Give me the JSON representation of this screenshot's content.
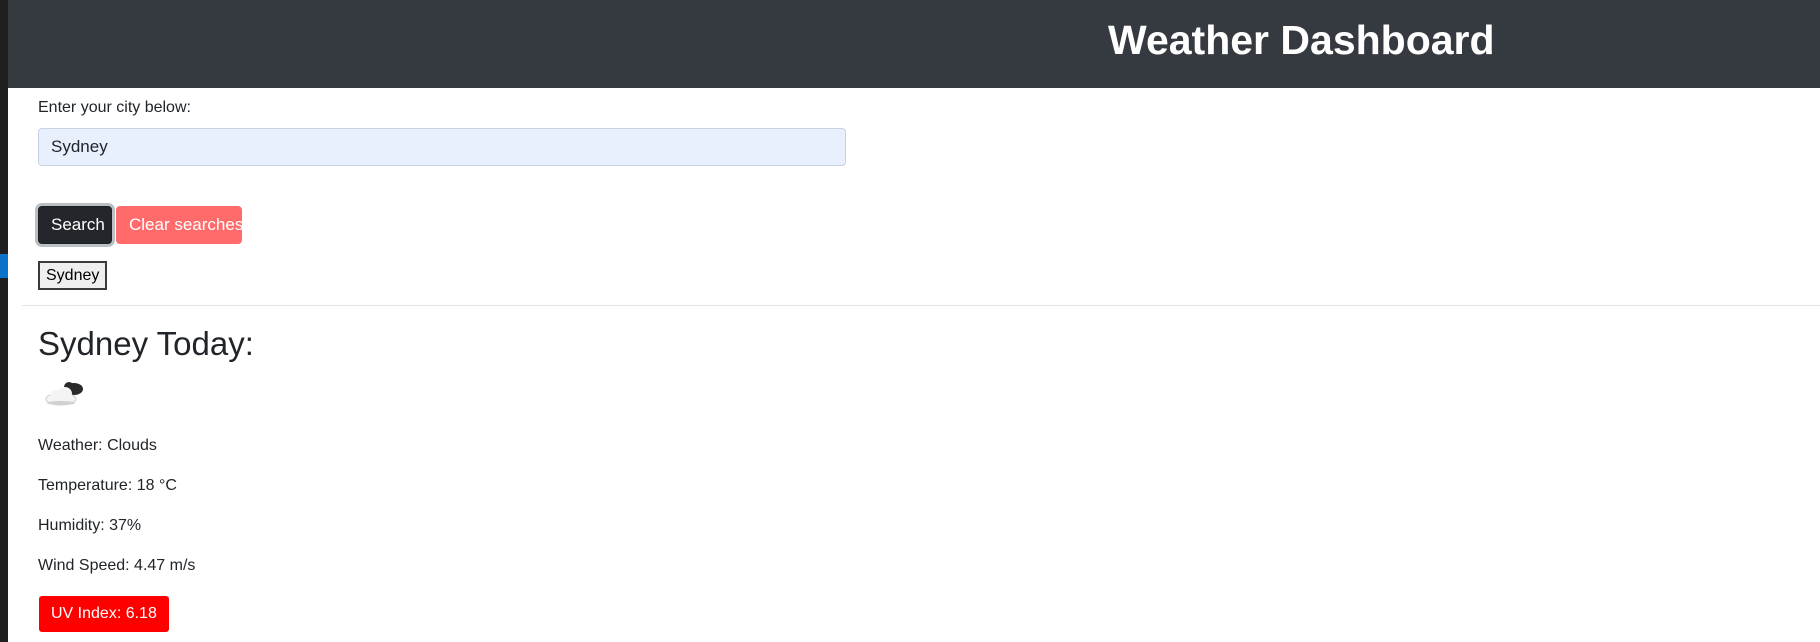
{
  "header": {
    "title": "Weather Dashboard"
  },
  "search": {
    "label": "Enter your city below:",
    "value": "Sydney",
    "search_button": "Search",
    "clear_button": "Clear searches"
  },
  "history": [
    {
      "label": "Sydney"
    }
  ],
  "current": {
    "title": "Sydney Today:",
    "icon": "cloud-icon",
    "weather": "Weather: Clouds",
    "temperature": "Temperature: 18 °C",
    "humidity": "Humidity: 37%",
    "wind": "Wind Speed: 4.47 m/s",
    "uv": "UV Index: 6.18"
  },
  "colors": {
    "header_bg": "#343a40",
    "search_button": "#23272b",
    "clear_button": "#ff6b6b",
    "uv_high": "#ff0000",
    "input_bg": "#e8f0fe"
  }
}
